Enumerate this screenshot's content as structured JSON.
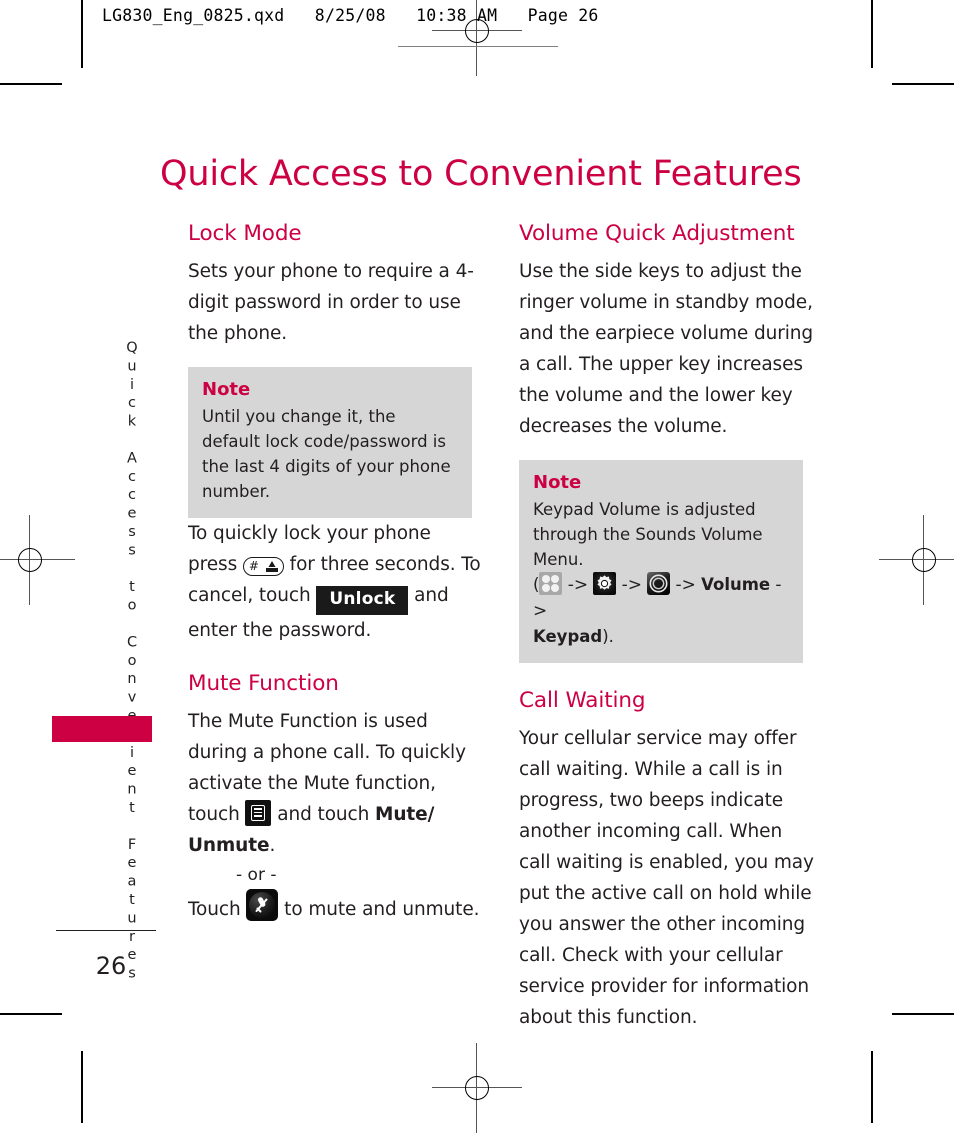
{
  "slug": {
    "text": "LG830_Eng_0825.qxd   8/25/08   10:38 AM   Page 26"
  },
  "page": {
    "title": "Quick Access to Convenient Features",
    "sidebar_label": "Quick Access to Convenient Features",
    "folio": "26",
    "accent_color": "#cc0043",
    "note_bg_color": "#d6d6d6",
    "text_color": "#231f20"
  },
  "left_column": {
    "lock_mode": {
      "heading": "Lock Mode",
      "paragraph": "Sets your phone to require a 4-digit password in order to use the phone.",
      "note": {
        "title": "Note",
        "body": "Until you change it, the default lock code/password is the last 4 digits of your phone number."
      },
      "instruction_1": "To quickly lock your phone press",
      "instruction_2": "for three seconds. To cancel, touch",
      "unlock_button": "Unlock",
      "instruction_3": "and enter the password.",
      "key_icon_label": "#",
      "key_icon_name": "hash-space-key-icon"
    },
    "mute_function": {
      "heading": "Mute Function",
      "paragraph_1": "The Mute Function is used during a phone call. To quickly activate the Mute function, touch",
      "menu_icon_name": "menu-list-icon",
      "paragraph_2_pre": "and touch",
      "paragraph_2_bold": "Mute/ Unmute",
      "paragraph_2_post": ".",
      "or_separator": "- or -",
      "touch_label": "Touch",
      "mute_icon_name": "mute-microphone-icon",
      "touch_tail": "to mute and unmute."
    }
  },
  "right_column": {
    "volume_quick_adjustment": {
      "heading": "Volume Quick Adjustment",
      "paragraph": "Use the side keys to adjust the ringer volume in standby mode, and the earpiece volume during a call. The upper key increases the volume and the lower key decreases the volume.",
      "note": {
        "title": "Note",
        "line_1": "Keypad Volume is adjusted",
        "line_2": "through the Sounds Volume Menu.",
        "path_open": "(",
        "arrow": "->",
        "path_volume": "Volume",
        "path_keypad": "Keypad",
        "path_close": ").",
        "icon_1_name": "menu-grid-icon",
        "icon_2_name": "settings-gear-icon",
        "icon_3_name": "sounds-speaker-icon"
      }
    },
    "call_waiting": {
      "heading": "Call Waiting",
      "paragraph": "Your cellular service may offer call waiting. While a call is in progress, two beeps indicate another incoming call. When call waiting is enabled, you may put the active call on hold while you answer the other incoming call. Check with your cellular service provider for information about this function."
    }
  }
}
